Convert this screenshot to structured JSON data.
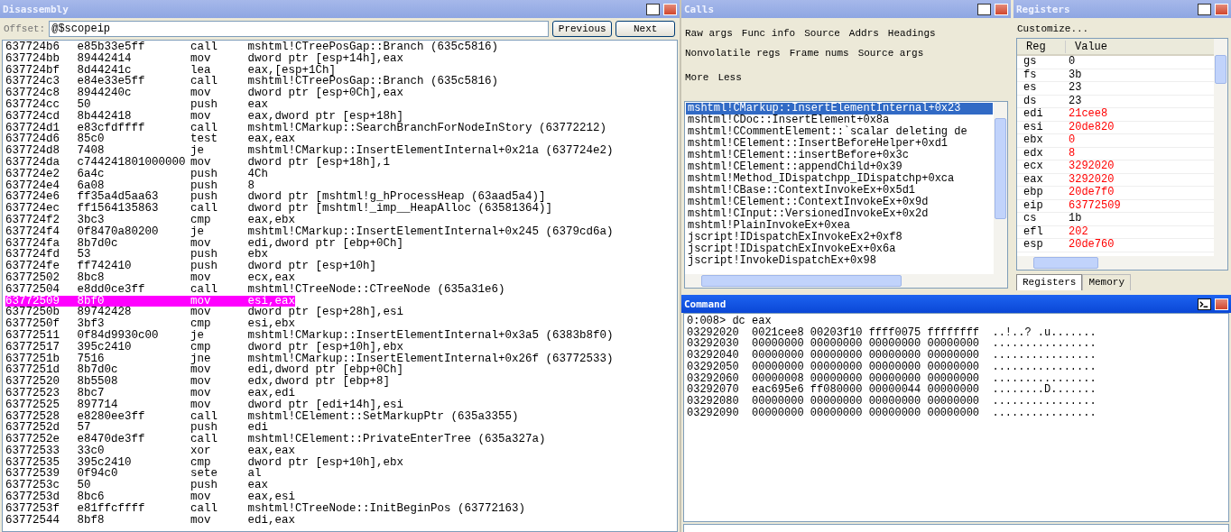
{
  "disassembly": {
    "title": "Disassembly",
    "active": false,
    "offset_label": "Offset:",
    "offset_value": "@$scopeip",
    "buttons": [
      "Previous",
      "Next"
    ],
    "lines": [
      {
        "address": "637724b6",
        "bytes": "e85b33e5ff",
        "mnemonic": "call",
        "operands": "mshtml!CTreePosGap::Branch (635c5816)",
        "selected": false
      },
      {
        "address": "637724bb",
        "bytes": "89442414",
        "mnemonic": "mov",
        "operands": "dword ptr [esp+14h],eax",
        "selected": false
      },
      {
        "address": "637724bf",
        "bytes": "8d44241c",
        "mnemonic": "lea",
        "operands": "eax,[esp+1Ch]",
        "selected": false
      },
      {
        "address": "637724c3",
        "bytes": "e84e33e5ff",
        "mnemonic": "call",
        "operands": "mshtml!CTreePosGap::Branch (635c5816)",
        "selected": false
      },
      {
        "address": "637724c8",
        "bytes": "8944240c",
        "mnemonic": "mov",
        "operands": "dword ptr [esp+0Ch],eax",
        "selected": false
      },
      {
        "address": "637724cc",
        "bytes": "50",
        "mnemonic": "push",
        "operands": "eax",
        "selected": false
      },
      {
        "address": "637724cd",
        "bytes": "8b442418",
        "mnemonic": "mov",
        "operands": "eax,dword ptr [esp+18h]",
        "selected": false
      },
      {
        "address": "637724d1",
        "bytes": "e83cfdffff",
        "mnemonic": "call",
        "operands": "mshtml!CMarkup::SearchBranchForNodeInStory (63772212)",
        "selected": false
      },
      {
        "address": "637724d6",
        "bytes": "85c0",
        "mnemonic": "test",
        "operands": "eax,eax",
        "selected": false
      },
      {
        "address": "637724d8",
        "bytes": "7408",
        "mnemonic": "je",
        "operands": "mshtml!CMarkup::InsertElementInternal+0x21a (637724e2)",
        "selected": false
      },
      {
        "address": "637724da",
        "bytes": "c744241801000000",
        "mnemonic": "mov",
        "operands": "dword ptr [esp+18h],1",
        "selected": false
      },
      {
        "address": "637724e2",
        "bytes": "6a4c",
        "mnemonic": "push",
        "operands": "4Ch",
        "selected": false
      },
      {
        "address": "637724e4",
        "bytes": "6a08",
        "mnemonic": "push",
        "operands": "8",
        "selected": false
      },
      {
        "address": "637724e6",
        "bytes": "ff35a4d5aa63",
        "mnemonic": "push",
        "operands": "dword ptr [mshtml!g_hProcessHeap (63aad5a4)]",
        "selected": false
      },
      {
        "address": "637724ec",
        "bytes": "ff1564135863",
        "mnemonic": "call",
        "operands": "dword ptr [mshtml!_imp__HeapAlloc (63581364)]",
        "selected": false
      },
      {
        "address": "637724f2",
        "bytes": "3bc3",
        "mnemonic": "cmp",
        "operands": "eax,ebx",
        "selected": false
      },
      {
        "address": "637724f4",
        "bytes": "0f8470a80200",
        "mnemonic": "je",
        "operands": "mshtml!CMarkup::InsertElementInternal+0x245 (6379cd6a)",
        "selected": false
      },
      {
        "address": "637724fa",
        "bytes": "8b7d0c",
        "mnemonic": "mov",
        "operands": "edi,dword ptr [ebp+0Ch]",
        "selected": false
      },
      {
        "address": "637724fd",
        "bytes": "53",
        "mnemonic": "push",
        "operands": "ebx",
        "selected": false
      },
      {
        "address": "637724fe",
        "bytes": "ff742410",
        "mnemonic": "push",
        "operands": "dword ptr [esp+10h]",
        "selected": false
      },
      {
        "address": "63772502",
        "bytes": "8bc8",
        "mnemonic": "mov",
        "operands": "ecx,eax",
        "selected": false
      },
      {
        "address": "63772504",
        "bytes": "e8dd0ce3ff",
        "mnemonic": "call",
        "operands": "mshtml!CTreeNode::CTreeNode (635a31e6)",
        "selected": false
      },
      {
        "address": "63772509",
        "bytes": "8bf0",
        "mnemonic": "mov",
        "operands": "esi,eax",
        "selected": true
      },
      {
        "address": "6377250b",
        "bytes": "89742428",
        "mnemonic": "mov",
        "operands": "dword ptr [esp+28h],esi",
        "selected": false
      },
      {
        "address": "6377250f",
        "bytes": "3bf3",
        "mnemonic": "cmp",
        "operands": "esi,ebx",
        "selected": false
      },
      {
        "address": "63772511",
        "bytes": "0f84d9930c00",
        "mnemonic": "je",
        "operands": "mshtml!CMarkup::InsertElementInternal+0x3a5 (6383b8f0)",
        "selected": false
      },
      {
        "address": "63772517",
        "bytes": "395c2410",
        "mnemonic": "cmp",
        "operands": "dword ptr [esp+10h],ebx",
        "selected": false
      },
      {
        "address": "6377251b",
        "bytes": "7516",
        "mnemonic": "jne",
        "operands": "mshtml!CMarkup::InsertElementInternal+0x26f (63772533)",
        "selected": false
      },
      {
        "address": "6377251d",
        "bytes": "8b7d0c",
        "mnemonic": "mov",
        "operands": "edi,dword ptr [ebp+0Ch]",
        "selected": false
      },
      {
        "address": "63772520",
        "bytes": "8b5508",
        "mnemonic": "mov",
        "operands": "edx,dword ptr [ebp+8]",
        "selected": false
      },
      {
        "address": "63772523",
        "bytes": "8bc7",
        "mnemonic": "mov",
        "operands": "eax,edi",
        "selected": false
      },
      {
        "address": "63772525",
        "bytes": "897714",
        "mnemonic": "mov",
        "operands": "dword ptr [edi+14h],esi",
        "selected": false
      },
      {
        "address": "63772528",
        "bytes": "e8280ee3ff",
        "mnemonic": "call",
        "operands": "mshtml!CElement::SetMarkupPtr (635a3355)",
        "selected": false
      },
      {
        "address": "6377252d",
        "bytes": "57",
        "mnemonic": "push",
        "operands": "edi",
        "selected": false
      },
      {
        "address": "6377252e",
        "bytes": "e8470de3ff",
        "mnemonic": "call",
        "operands": "mshtml!CElement::PrivateEnterTree (635a327a)",
        "selected": false
      },
      {
        "address": "63772533",
        "bytes": "33c0",
        "mnemonic": "xor",
        "operands": "eax,eax",
        "selected": false
      },
      {
        "address": "63772535",
        "bytes": "395c2410",
        "mnemonic": "cmp",
        "operands": "dword ptr [esp+10h],ebx",
        "selected": false
      },
      {
        "address": "63772539",
        "bytes": "0f94c0",
        "mnemonic": "sete",
        "operands": "al",
        "selected": false
      },
      {
        "address": "6377253c",
        "bytes": "50",
        "mnemonic": "push",
        "operands": "eax",
        "selected": false
      },
      {
        "address": "6377253d",
        "bytes": "8bc6",
        "mnemonic": "mov",
        "operands": "eax,esi",
        "selected": false
      },
      {
        "address": "6377253f",
        "bytes": "e81ffcffff",
        "mnemonic": "call",
        "operands": "mshtml!CTreeNode::InitBeginPos (63772163)",
        "selected": false
      },
      {
        "address": "63772544",
        "bytes": "8bf8",
        "mnemonic": "mov",
        "operands": "edi,eax",
        "selected": false
      }
    ]
  },
  "calls": {
    "title": "Calls",
    "active": false,
    "options": [
      [
        "Raw args",
        "Func info",
        "Source",
        "Addrs",
        "Headings"
      ],
      [
        "Nonvolatile regs",
        "Frame nums",
        "Source args"
      ],
      [
        "More",
        "Less"
      ]
    ],
    "frames": [
      {
        "text": "mshtml!CMarkup::InsertElementInternal+0x23",
        "selected": true
      },
      {
        "text": "mshtml!CDoc::InsertElement+0x8a",
        "selected": false
      },
      {
        "text": "mshtml!CCommentElement::`scalar deleting de",
        "selected": false
      },
      {
        "text": "mshtml!CElement::InsertBeforeHelper+0xd1",
        "selected": false
      },
      {
        "text": "mshtml!CElement::insertBefore+0x3c",
        "selected": false
      },
      {
        "text": "mshtml!CElement::appendChild+0x39",
        "selected": false
      },
      {
        "text": "mshtml!Method_IDispatchpp_IDispatchp+0xca",
        "selected": false
      },
      {
        "text": "mshtml!CBase::ContextInvokeEx+0x5d1",
        "selected": false
      },
      {
        "text": "mshtml!CElement::ContextInvokeEx+0x9d",
        "selected": false
      },
      {
        "text": "mshtml!CInput::VersionedInvokeEx+0x2d",
        "selected": false
      },
      {
        "text": "mshtml!PlainInvokeEx+0xea",
        "selected": false
      },
      {
        "text": "jscript!IDispatchExInvokeEx2+0xf8",
        "selected": false
      },
      {
        "text": "jscript!IDispatchExInvokeEx+0x6a",
        "selected": false
      },
      {
        "text": "jscript!InvokeDispatchEx+0x98",
        "selected": false
      }
    ]
  },
  "registers": {
    "title": "Registers",
    "active": false,
    "customize": "Customize...",
    "columns": [
      "Reg",
      "Value"
    ],
    "rows": [
      {
        "name": "gs",
        "value": "0",
        "changed": false
      },
      {
        "name": "fs",
        "value": "3b",
        "changed": false
      },
      {
        "name": "es",
        "value": "23",
        "changed": false
      },
      {
        "name": "ds",
        "value": "23",
        "changed": false
      },
      {
        "name": "edi",
        "value": "21cee8",
        "changed": true
      },
      {
        "name": "esi",
        "value": "20de820",
        "changed": true
      },
      {
        "name": "ebx",
        "value": "0",
        "changed": true
      },
      {
        "name": "edx",
        "value": "8",
        "changed": true
      },
      {
        "name": "ecx",
        "value": "3292020",
        "changed": true
      },
      {
        "name": "eax",
        "value": "3292020",
        "changed": true
      },
      {
        "name": "ebp",
        "value": "20de7f0",
        "changed": true
      },
      {
        "name": "eip",
        "value": "63772509",
        "changed": true
      },
      {
        "name": "cs",
        "value": "1b",
        "changed": false
      },
      {
        "name": "efl",
        "value": "202",
        "changed": true
      },
      {
        "name": "esp",
        "value": "20de760",
        "changed": true
      }
    ],
    "tabs": [
      {
        "label": "Registers",
        "selected": true
      },
      {
        "label": "Memory",
        "selected": false
      }
    ]
  },
  "command": {
    "title": "Command",
    "active": true,
    "output": [
      "0:008> dc eax",
      "03292020  0021cee8 00203f10 ffff0075 ffffffff  ..!..? .u.......",
      "03292030  00000000 00000000 00000000 00000000  ................",
      "03292040  00000000 00000000 00000000 00000000  ................",
      "03292050  00000000 00000000 00000000 00000000  ................",
      "03292060  00000008 00000000 00000000 00000000  ................",
      "03292070  eac695e6 ff080000 00000044 00000000  ........D.......",
      "03292080  00000000 00000000 00000000 00000000  ................",
      "03292090  00000000 00000000 00000000 00000000  ................"
    ]
  }
}
